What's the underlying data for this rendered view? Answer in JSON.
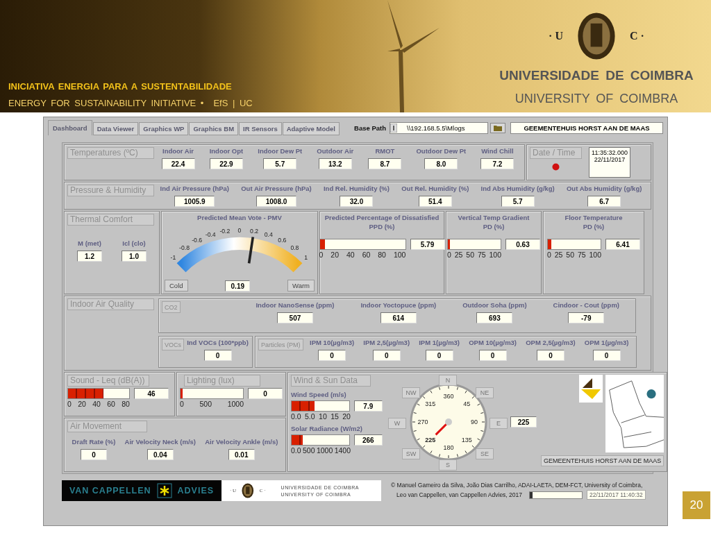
{
  "header": {
    "initiative": "INICIATIVA ENERGIA PARA A SUSTENTABILIDADE",
    "initiative_en": "ENERGY FOR SUSTAINABILITY INITIATIVE •",
    "initiative_tag": "EfS | UC",
    "logo_left": "· U",
    "logo_right": "C ·",
    "university_pt": "UNIVERSIDADE DE COIMBRA",
    "university_en": "UNIVERSITY OF COIMBRA"
  },
  "dashboard": {
    "tabs": [
      {
        "label": "Dashboard",
        "selected": true
      },
      {
        "label": "Data Viewer",
        "selected": false
      },
      {
        "label": "Graphics WP",
        "selected": false
      },
      {
        "label": "Graphics BM",
        "selected": false
      },
      {
        "label": "IR Sensors",
        "selected": false
      },
      {
        "label": "Adaptive Model",
        "selected": false
      }
    ],
    "base_path": {
      "label": "Base Path",
      "value": "\\\\192.168.5.5\\Mlogs"
    },
    "location": "GEEMENTEHUIS HORST AAN DE MAAS",
    "temperatures": {
      "title": "Temperatures (ºC)",
      "readings": [
        {
          "label": "Indoor Air",
          "value": "22.4"
        },
        {
          "label": "Indoor Opt",
          "value": "22.9"
        },
        {
          "label": "Indoor Dew Pt",
          "value": "5.7"
        },
        {
          "label": "Outdoor Air",
          "value": "13.2"
        },
        {
          "label": "RMOT",
          "value": "8.7"
        },
        {
          "label": "Outdoor Dew Pt",
          "value": "8.0"
        },
        {
          "label": "Wind Chill",
          "value": "7.2"
        }
      ]
    },
    "date_time": {
      "title": "Date / Time",
      "led_on": true,
      "time": "11:35:32.000",
      "date": "22/11/2017"
    },
    "pressure_humidity": {
      "title": "Pressure & Humidity",
      "readings": [
        {
          "label": "Ind Air Pressure (hPa)",
          "value": "1005.9"
        },
        {
          "label": "Out Air Pressure (hPa)",
          "value": "1008.0"
        },
        {
          "label": "Ind Rel. Humidity (%)",
          "value": "32.0"
        },
        {
          "label": "Out Rel. Humidity (%)",
          "value": "51.4"
        },
        {
          "label": "Ind Abs Humidity (g/kg)",
          "value": "5.7"
        },
        {
          "label": "Out Abs Humidity (g/kg)",
          "value": "6.7"
        }
      ]
    },
    "thermal_comfort": {
      "title": "Thermal Comfort",
      "readings": [
        {
          "label": "M (met)",
          "value": "1.2"
        },
        {
          "label": "Icl (clo)",
          "value": "1.0"
        }
      ]
    },
    "pmv": {
      "title": "Predicted Mean Vote - PMV",
      "ticks": [
        "-1",
        "-0.8",
        "-0.6",
        "-0.4",
        "-0.2",
        "0",
        "0.2",
        "0.4",
        "0.6",
        "0.8",
        "1"
      ],
      "level": 0.595,
      "cold": "Cold",
      "warm": "Warm",
      "value": "0.19"
    },
    "pd_meters": [
      {
        "title": "Predicted Percentage of Dissatisfied",
        "subtitle": "PPD (%)",
        "value": "5.79",
        "level": 0.058,
        "ticks": [
          "0",
          "20",
          "40",
          "60",
          "80",
          "100"
        ]
      },
      {
        "title": "Vertical Temp Gradient",
        "subtitle": "PD (%)",
        "value": "0.63",
        "level": 0.006,
        "ticks": [
          "0",
          "25",
          "50",
          "75",
          "100"
        ]
      },
      {
        "title": "Floor Temperature",
        "subtitle": "PD (%)",
        "value": "6.41",
        "level": 0.064,
        "ticks": [
          "0",
          "25",
          "50",
          "75",
          "100"
        ]
      }
    ],
    "air_quality": {
      "title": "Indoor Air Quality",
      "groups": [
        {
          "button": "CO2",
          "readings": [
            {
              "label": "Indoor NanoSense (ppm)",
              "value": "507"
            },
            {
              "label": "Indoor Yoctopuce (ppm)",
              "value": "614"
            },
            {
              "label": "Outdoor Soha (ppm)",
              "value": "693"
            },
            {
              "label": "Cindoor - Cout (ppm)",
              "value": "-79"
            }
          ]
        },
        {
          "button": "VOCs",
          "readings": [
            {
              "label": "Ind VOCs (100*ppb)",
              "value": "0"
            }
          ]
        },
        {
          "button": "Particles (PM)",
          "readings": [
            {
              "label": "IPM 10(µg/m3)",
              "value": "0"
            },
            {
              "label": "IPM 2,5(µg/m3)",
              "value": "0"
            },
            {
              "label": "IPM 1(µg/m3)",
              "value": "0"
            },
            {
              "label": "OPM 10(µg/m3)",
              "value": "0"
            },
            {
              "label": "OPM 2,5(µg/m3)",
              "value": "0"
            },
            {
              "label": "OPM 1(µg/m3)",
              "value": "0"
            }
          ]
        }
      ]
    },
    "sound": {
      "title": "Sound - Leq (dB(A))",
      "value": "46",
      "level": 0.575,
      "ticks": [
        "0",
        "20",
        "40",
        "60",
        "80"
      ]
    },
    "lighting": {
      "title": "Lighting (lux)",
      "value": "0",
      "level": 0.01,
      "ticks": [
        "0",
        "500",
        "1000"
      ]
    },
    "air_movement": {
      "title": "Air Movement",
      "readings": [
        {
          "label": "Draft Rate (%)",
          "value": "0"
        },
        {
          "label": "Air Velocity Neck (m/s)",
          "value": "0.04"
        },
        {
          "label": "Air Velocity Ankle (m/s)",
          "value": "0.01"
        }
      ]
    },
    "wind_sun": {
      "title": "Wind & Sun Data",
      "meters": [
        {
          "title": "Wind Speed (m/s)",
          "value": "7.9",
          "level": 0.395,
          "ticks": [
            "0.0",
            "5.0",
            "10",
            "15",
            "20"
          ]
        },
        {
          "title": "Solar Radiance (W/m2)",
          "value": "266",
          "level": 0.19,
          "ticks": [
            "0.0",
            "500",
            "1000",
            "1400"
          ]
        }
      ],
      "compass": {
        "directions": [
          "N",
          "NE",
          "E",
          "SE",
          "S",
          "SW",
          "W",
          "NW"
        ],
        "dial_labels": [
          {
            "label": "360",
            "selected": false
          },
          {
            "label": "45",
            "selected": false
          },
          {
            "label": "90",
            "selected": false
          },
          {
            "label": "135",
            "selected": false
          },
          {
            "label": "180",
            "selected": false
          },
          {
            "label": "225",
            "selected": true
          },
          {
            "label": "270",
            "selected": false
          },
          {
            "label": "315",
            "selected": false
          }
        ],
        "value": "225"
      },
      "location": "GEMEENTEHUIS HORST AAN DE MAAS"
    },
    "footer": {
      "sponsor_left": "VAN CAPPELLEN",
      "sponsor_right": "ADVIES",
      "uc_left": "· U",
      "uc_right": "C ·",
      "uc_pt": "UNIVERSIDADE DE COIMBRA",
      "uc_en": "UNIVERSITY OF COIMBRA",
      "credits": [
        "© Manuel Gameiro da Silva, João Dias Carrilho, ADAI-LAETA, DEM-FCT, University  of Coimbra,",
        "Leo van Cappellen, van Cappellen Advies, 2017"
      ],
      "level": 0.05,
      "timestamp": "22/11/2017 11:40:32"
    }
  },
  "page_number": "20"
}
